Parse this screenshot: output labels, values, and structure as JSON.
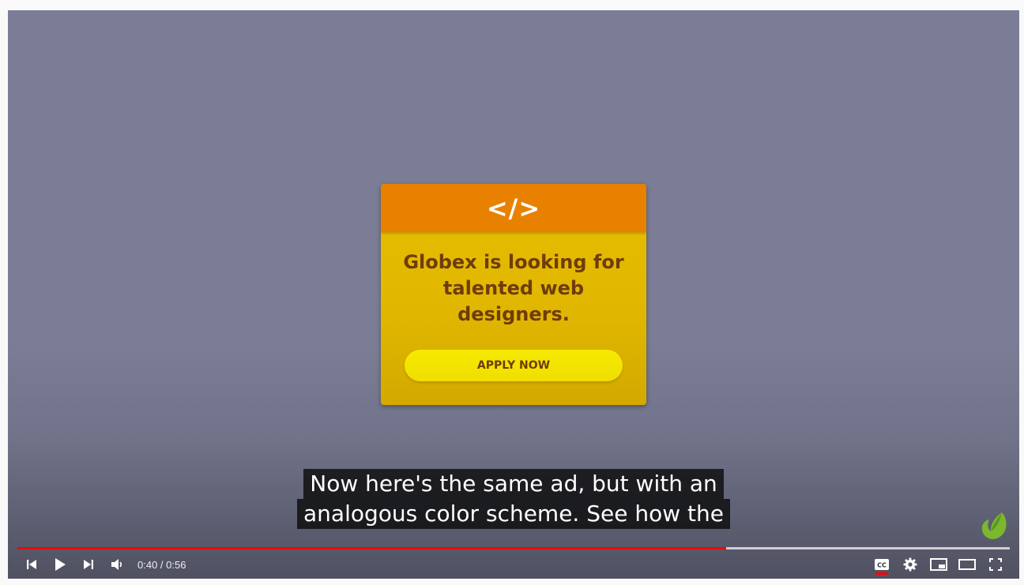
{
  "ad": {
    "icon": "code-icon",
    "icon_glyph": "</>",
    "headline": "Globex is looking for talented web designers.",
    "cta": "APPLY NOW",
    "colors": {
      "header": "#e98100",
      "body": "#e0b600",
      "button": "#f2e300",
      "text": "#6e3c0a"
    }
  },
  "captions": {
    "line1": "Now here's the same ad, but with an",
    "line2": "analogous color scheme. See how the"
  },
  "player": {
    "current_time": "0:40",
    "separator": " / ",
    "duration": "0:56",
    "progress_fraction": 0.714,
    "buffered_fraction": 1.0,
    "accent": "#ff0000",
    "watermark": "envato-leaf-icon"
  },
  "controls_left": [
    "previous-icon",
    "play-icon",
    "next-icon",
    "volume-icon"
  ],
  "controls_right": [
    "captions-icon",
    "settings-icon",
    "miniplayer-icon",
    "theater-icon",
    "fullscreen-icon"
  ]
}
